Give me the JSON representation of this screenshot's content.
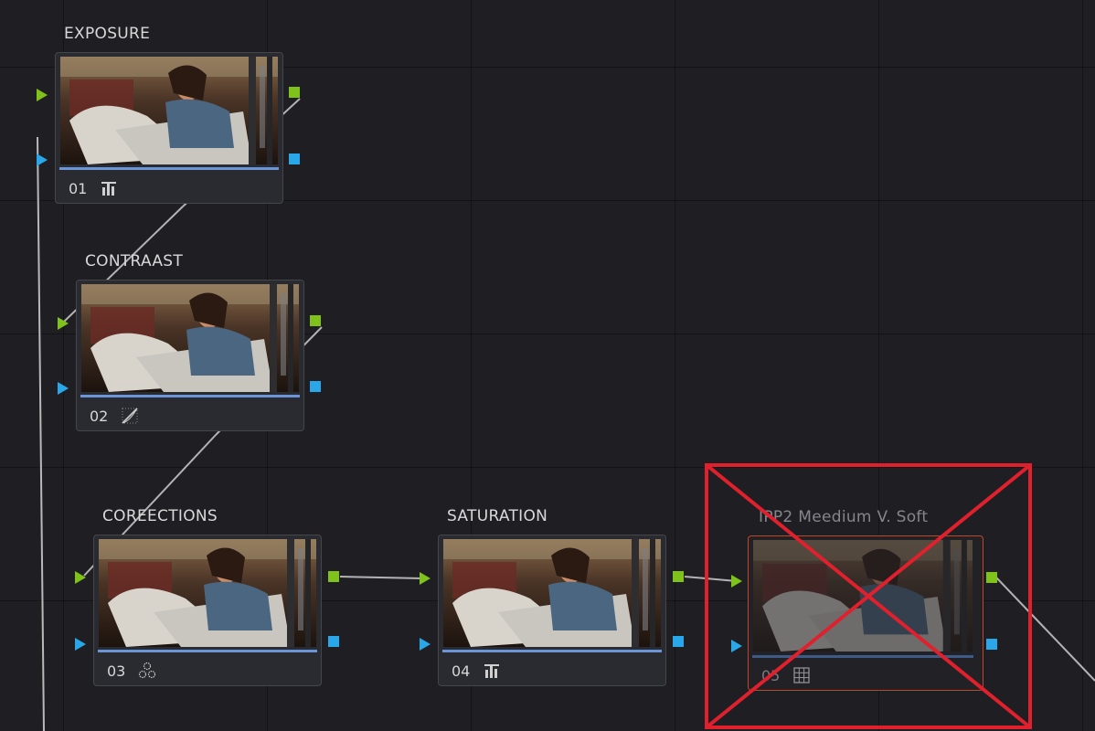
{
  "nodes": [
    {
      "id": "exposure",
      "title": "EXPOSURE",
      "number": "01",
      "icon": "bar-chart-icon"
    },
    {
      "id": "contrast",
      "title": "CONTRAAST",
      "number": "02",
      "icon": "curves-icon"
    },
    {
      "id": "corrections",
      "title": "COREECTIONS",
      "number": "03",
      "icon": "color-wheels-icon"
    },
    {
      "id": "saturation",
      "title": "SATURATION",
      "number": "04",
      "icon": "bar-chart-icon"
    },
    {
      "id": "lut",
      "title": "IPP2 Meedium V. Soft",
      "number": "05",
      "icon": "lut-grid-icon",
      "disabled": true
    }
  ],
  "colors": {
    "background": "#1f1f23",
    "node_border": "#45464c",
    "rgb_port": "#7ec21a",
    "alpha_port": "#29a7e8",
    "disabled_border": "#c0462a",
    "x_mark": "#e0202d"
  }
}
